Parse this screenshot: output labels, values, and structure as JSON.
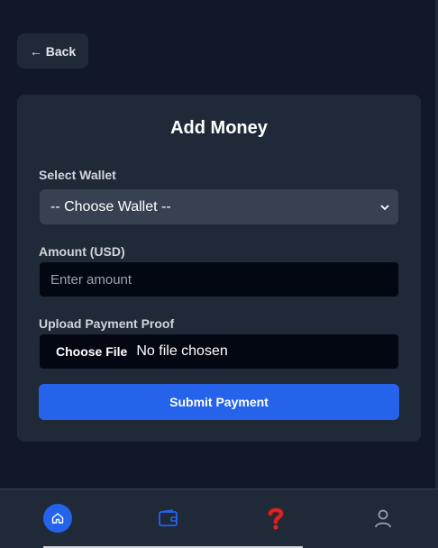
{
  "header": {
    "back_label": "← Back"
  },
  "form": {
    "title": "Add Money",
    "wallet_label": "Select Wallet",
    "wallet_selected": "-- Choose Wallet --",
    "amount_label": "Amount (USD)",
    "amount_placeholder": "Enter amount",
    "proof_label": "Upload Payment Proof",
    "file_button": "Choose File",
    "file_status": "No file chosen",
    "submit_label": "Submit Payment"
  },
  "nav": {
    "items": [
      {
        "icon": "home-icon",
        "active": true
      },
      {
        "icon": "wallet-icon",
        "active": false
      },
      {
        "icon": "question-icon",
        "active": false
      },
      {
        "icon": "user-icon",
        "active": false
      }
    ]
  },
  "colors": {
    "background": "#111827",
    "card": "#1f2937",
    "accent": "#2563eb",
    "help": "#dc2626"
  }
}
